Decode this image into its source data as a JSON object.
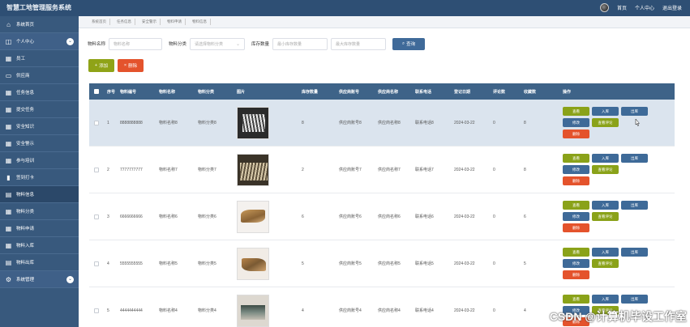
{
  "app": {
    "title": "智慧工地管理服务系统"
  },
  "topbar": {
    "home": "首页",
    "profile": "个人中心",
    "logout": "退出登录"
  },
  "sidebar": {
    "items": [
      {
        "label": "系统首页",
        "icon": "home-icon",
        "type": "item"
      },
      {
        "label": "个人中心",
        "icon": "user-icon",
        "type": "group"
      },
      {
        "label": "员工",
        "icon": "grid-icon",
        "type": "item"
      },
      {
        "label": "供应商",
        "icon": "monitor-icon",
        "type": "item"
      },
      {
        "label": "任务信息",
        "icon": "grid-icon",
        "type": "item"
      },
      {
        "label": "提交任务",
        "icon": "grid-icon",
        "type": "item"
      },
      {
        "label": "安全知识",
        "icon": "grid-icon",
        "type": "item"
      },
      {
        "label": "安全警示",
        "icon": "grid-icon",
        "type": "item"
      },
      {
        "label": "参与培训",
        "icon": "grid-icon",
        "type": "item"
      },
      {
        "label": "签到打卡",
        "icon": "chart-icon",
        "type": "item"
      },
      {
        "label": "物料信息",
        "icon": "doc-icon",
        "type": "active"
      },
      {
        "label": "物料分类",
        "icon": "grid-icon",
        "type": "item"
      },
      {
        "label": "物料申请",
        "icon": "grid-icon",
        "type": "item"
      },
      {
        "label": "物料入库",
        "icon": "grid-icon",
        "type": "item"
      },
      {
        "label": "物料出库",
        "icon": "doc-icon",
        "type": "item"
      },
      {
        "label": "系统管理",
        "icon": "gear-icon",
        "type": "group"
      }
    ]
  },
  "breadcrumbs": [
    "系统首页",
    "任务信息",
    "安全警示",
    "物料申请",
    "物料信息"
  ],
  "search": {
    "name_label": "物料名称",
    "name_placeholder": "物料名称",
    "cat_label": "物料分类",
    "cat_placeholder": "请选择物料分类",
    "stock_label": "库存数量",
    "stock_min_placeholder": "最小库存数量",
    "stock_max_placeholder": "最大库存数量",
    "button": "查询"
  },
  "toolbar": {
    "add": "添加",
    "delete": "删除"
  },
  "table": {
    "headers": [
      "序号",
      "物料编号",
      "物料名称",
      "物料分类",
      "图片",
      "库存数量",
      "供应商账号",
      "供应商名称",
      "联系电话",
      "登记日期",
      "评论数",
      "收藏数",
      "操作"
    ],
    "ops": {
      "view": "查看",
      "in": "入库",
      "out": "出库",
      "edit": "修改",
      "review": "查看评论",
      "delete": "删除"
    },
    "rows": [
      {
        "idx": "1",
        "no": "8888888888",
        "name": "物料名称8",
        "cat": "物料分类8",
        "img": "t1",
        "stock": "8",
        "sup": "供应商账号8",
        "supn": "供应商名称8",
        "tel": "联系电话8",
        "date": "2024-03-22",
        "rev": "0",
        "fav": "8"
      },
      {
        "idx": "2",
        "no": "7777777777",
        "name": "物料名称7",
        "cat": "物料分类7",
        "img": "t2",
        "stock": "2",
        "sup": "供应商账号7",
        "supn": "供应商名称7",
        "tel": "联系电话7",
        "date": "2024-03-22",
        "rev": "0",
        "fav": "8"
      },
      {
        "idx": "3",
        "no": "6666666666",
        "name": "物料名称6",
        "cat": "物料分类6",
        "img": "t3",
        "stock": "6",
        "sup": "供应商账号6",
        "supn": "供应商名称6",
        "tel": "联系电话6",
        "date": "2024-03-22",
        "rev": "0",
        "fav": "6"
      },
      {
        "idx": "4",
        "no": "5555555555",
        "name": "物料名称5",
        "cat": "物料分类5",
        "img": "t4",
        "stock": "5",
        "sup": "供应商账号5",
        "supn": "供应商名称5",
        "tel": "联系电话5",
        "date": "2024-03-22",
        "rev": "0",
        "fav": "5"
      },
      {
        "idx": "5",
        "no": "4444444444",
        "name": "物料名称4",
        "cat": "物料分类4",
        "img": "t5",
        "stock": "4",
        "sup": "供应商账号4",
        "supn": "供应商名称4",
        "tel": "联系电话4",
        "date": "2024-03-22",
        "rev": "0",
        "fav": "4"
      }
    ]
  },
  "watermark": "CSDN @计算机毕设工作室",
  "colors": {
    "topbar": "#2e4f74",
    "sidebar": "#38597d",
    "header": "#3e6388",
    "olive": "#8aa219",
    "red": "#e4532c"
  }
}
